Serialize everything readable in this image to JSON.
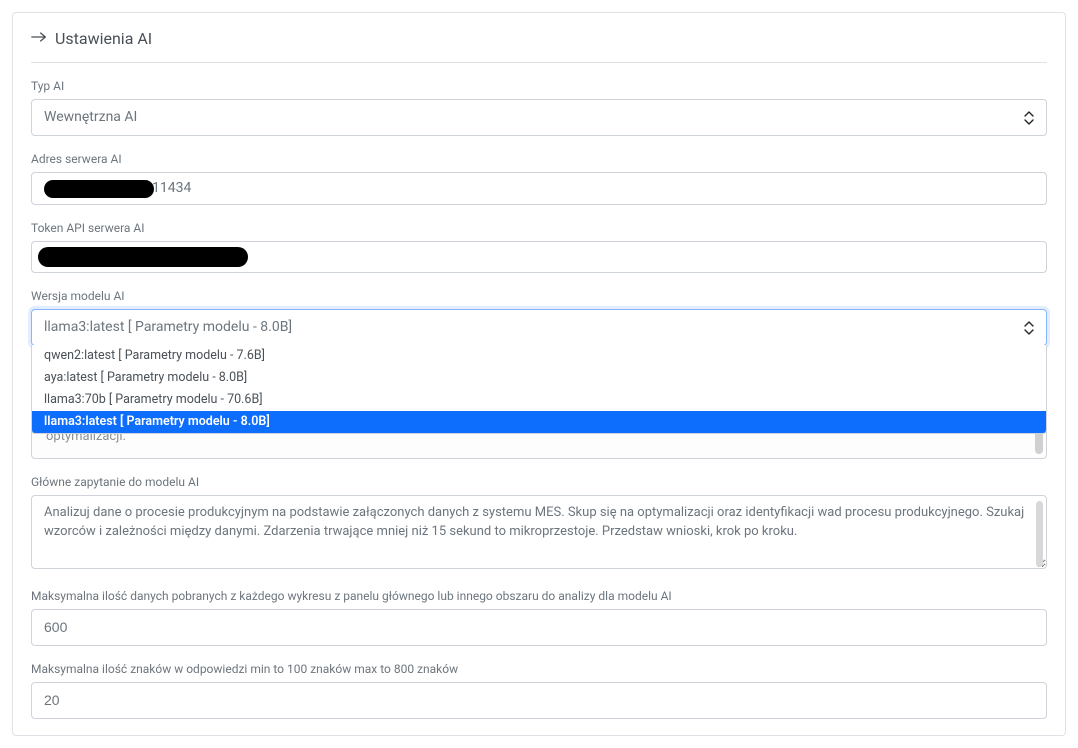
{
  "header": {
    "title": "Ustawienia AI"
  },
  "fields": {
    "type_ai": {
      "label": "Typ AI",
      "value": "Wewnętrzna AI"
    },
    "server_address": {
      "label": "Adres serwera AI",
      "suffix": "11434"
    },
    "api_token": {
      "label": "Token API serwera AI"
    },
    "model_version": {
      "label": "Wersja modelu AI",
      "selected": "llama3:latest [ Parametry modelu - 8.0B]",
      "options": [
        "qwen2:latest [ Parametry modelu - 7.6B]",
        "aya:latest [ Parametry modelu - 8.0B]",
        "llama3:70b [ Parametry modelu - 70.6B]",
        "llama3:latest [ Parametry modelu - 8.0B]"
      ]
    },
    "behind_fragment": "optymalizacji.",
    "main_query": {
      "label": "Główne zapytanie do modelu AI",
      "value": "Analizuj dane o procesie produkcyjnym na podstawie załączonych danych z systemu MES. Skup się na optymalizacji oraz identyfikacji wad procesu produkcyjnego. Szukaj wzorców i zależności między danymi. Zdarzenia trwające mniej niż 15 sekund to mikroprzestoje. Przedstaw wnioski, krok po kroku."
    },
    "max_data": {
      "label": "Maksymalna ilość danych pobranych z każdego wykresu z panelu głównego lub innego obszaru do analizy dla modelu AI",
      "value": "600"
    },
    "max_chars": {
      "label": "Maksymalna ilość znaków w odpowiedzi min to 100 znaków max to 800 znaków",
      "value": "20"
    }
  }
}
